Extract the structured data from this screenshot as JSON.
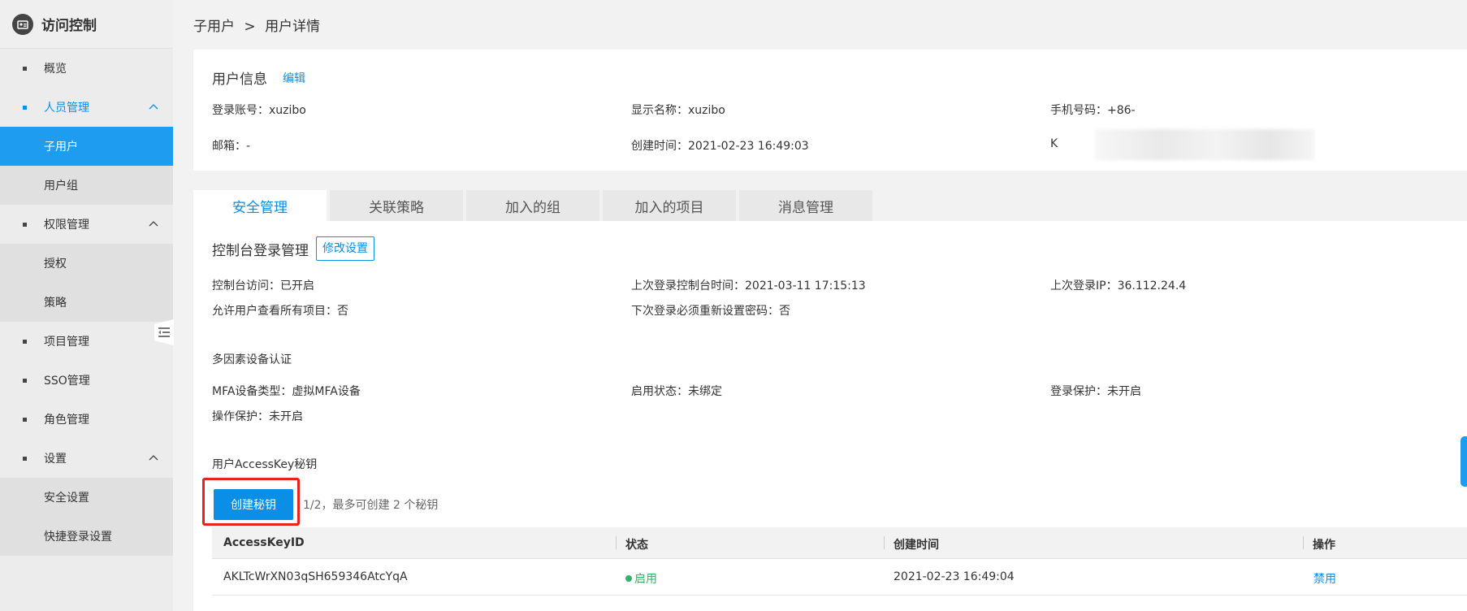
{
  "sidebar": {
    "title": "访问控制",
    "items": [
      {
        "label": "概览"
      },
      {
        "label": "人员管理"
      },
      {
        "label": "子用户"
      },
      {
        "label": "用户组"
      },
      {
        "label": "权限管理"
      },
      {
        "label": "授权"
      },
      {
        "label": "策略"
      },
      {
        "label": "项目管理"
      },
      {
        "label": "SSO管理"
      },
      {
        "label": "角色管理"
      },
      {
        "label": "设置"
      },
      {
        "label": "安全设置"
      },
      {
        "label": "快捷登录设置"
      }
    ]
  },
  "breadcrumb": {
    "parent": "子用户",
    "separator": ">",
    "current": "用户详情"
  },
  "user_info": {
    "title": "用户信息",
    "edit": "编辑",
    "login_account": "登录账号：xuzibo",
    "display_name": "显示名称：xuzibo",
    "phone": "手机号码：+86-",
    "email": "邮箱：-",
    "created_at": "创建时间：2021-02-23 16:49:03",
    "key_prefix": "K"
  },
  "tabs": [
    "安全管理",
    "关联策略",
    "加入的组",
    "加入的项目",
    "消息管理"
  ],
  "console_login": {
    "title": "控制台登录管理",
    "modify_button": "修改设置",
    "access": "控制台访问：已开启",
    "last_login_time": "上次登录控制台时间：2021-03-11 17:15:13",
    "last_login_ip": "上次登录IP：36.112.24.4",
    "view_all_projects": "允许用户查看所有项目：否",
    "reset_password": "下次登录必须重新设置密码：否"
  },
  "mfa": {
    "title": "多因素设备认证",
    "device_type": "MFA设备类型：虚拟MFA设备",
    "enabled_status": "启用状态：未绑定",
    "login_protection": "登录保护：未开启",
    "operation_protection": "操作保护：未开启"
  },
  "access_keys": {
    "title": "用户AccessKey秘钥",
    "create_button": "创建秘钥",
    "quota": "1/2，最多可创建 2 个秘钥",
    "columns": [
      "AccessKeyID",
      "状态",
      "创建时间",
      "操作"
    ],
    "rows": [
      {
        "id": "AKLTcWrXN03qSH659346AtcYqA",
        "status": "启用",
        "created": "2021-02-23 16:49:04",
        "action": "禁用"
      }
    ]
  },
  "colors": {
    "accent": "#0a8ee6",
    "active_nav": "#1e9df0",
    "highlight_border": "#e8231d",
    "status_ok": "#2fb46a"
  }
}
